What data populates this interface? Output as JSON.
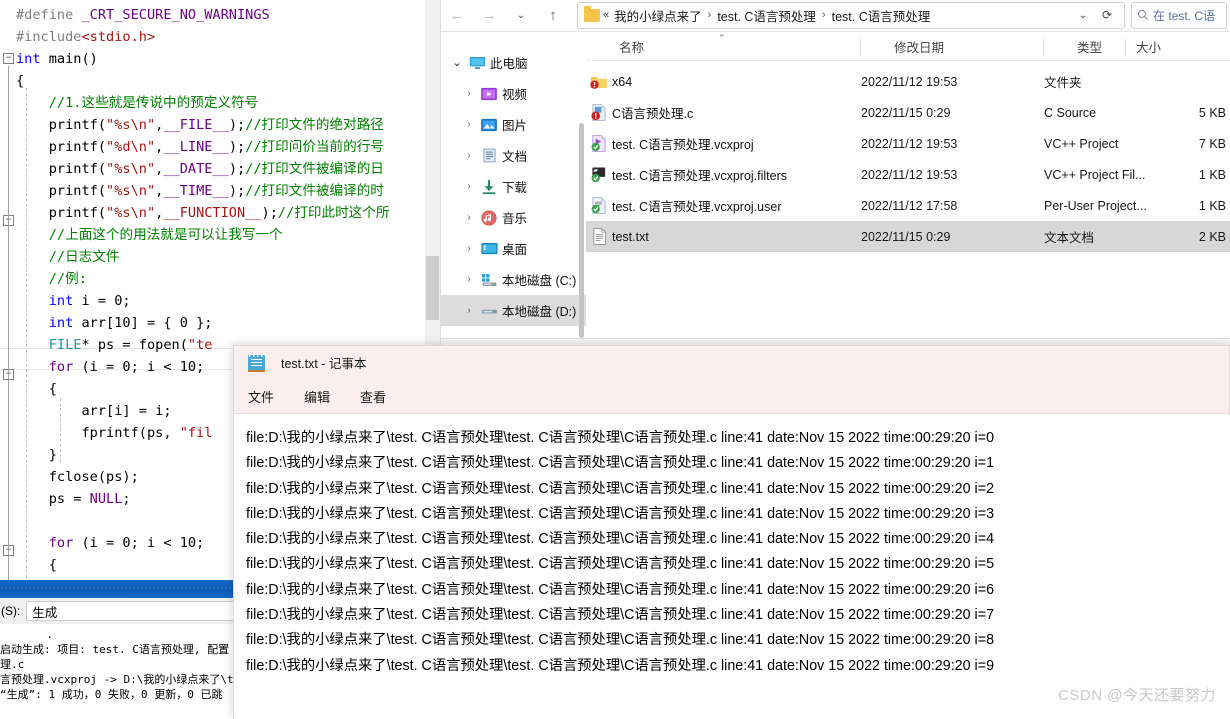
{
  "vs": {
    "code_lines": [
      [
        {
          "t": "#define ",
          "c": "gray"
        },
        {
          "t": "_CRT_SECURE_NO_WARNINGS",
          "c": "purple"
        }
      ],
      [
        {
          "t": "#include",
          "c": "gray"
        },
        {
          "t": "<stdio.h>",
          "c": "red"
        }
      ],
      [
        {
          "t": "int",
          "c": "blue"
        },
        {
          "t": " main()",
          "c": "black"
        }
      ],
      [
        {
          "t": "{",
          "c": "black"
        }
      ],
      [
        {
          "t": "    //1.这些就是传说中的预定义符号",
          "c": "green"
        }
      ],
      [
        {
          "t": "    printf(",
          "c": "black"
        },
        {
          "t": "\"%s\\n\"",
          "c": "str"
        },
        {
          "t": ",",
          "c": "black"
        },
        {
          "t": "__FILE__",
          "c": "purple"
        },
        {
          "t": ");",
          "c": "black"
        },
        {
          "t": "//打印文件的绝对路径",
          "c": "green"
        }
      ],
      [
        {
          "t": "    printf(",
          "c": "black"
        },
        {
          "t": "\"%d\\n\"",
          "c": "str"
        },
        {
          "t": ",",
          "c": "black"
        },
        {
          "t": "__LINE__",
          "c": "purple"
        },
        {
          "t": ");",
          "c": "black"
        },
        {
          "t": "//打印问价当前的行号",
          "c": "green"
        }
      ],
      [
        {
          "t": "    printf(",
          "c": "black"
        },
        {
          "t": "\"%s\\n\"",
          "c": "str"
        },
        {
          "t": ",",
          "c": "black"
        },
        {
          "t": "__DATE__",
          "c": "purple"
        },
        {
          "t": ");",
          "c": "black"
        },
        {
          "t": "//打印文件被编译的日",
          "c": "green"
        }
      ],
      [
        {
          "t": "    printf(",
          "c": "black"
        },
        {
          "t": "\"%s\\n\"",
          "c": "str"
        },
        {
          "t": ",",
          "c": "black"
        },
        {
          "t": "__TIME__",
          "c": "purple"
        },
        {
          "t": ");",
          "c": "black"
        },
        {
          "t": "//打印文件被编译的时",
          "c": "green"
        }
      ],
      [
        {
          "t": "    printf(",
          "c": "black"
        },
        {
          "t": "\"%s\\n\"",
          "c": "str"
        },
        {
          "t": ",",
          "c": "black"
        },
        {
          "t": "__FUNCTION__",
          "c": "red"
        },
        {
          "t": ");",
          "c": "black"
        },
        {
          "t": "//打印此时这个所",
          "c": "green"
        }
      ],
      [
        {
          "t": "    //上面这个的用法就是可以让我写一个",
          "c": "green"
        }
      ],
      [
        {
          "t": "    //日志文件",
          "c": "green"
        }
      ],
      [
        {
          "t": "    //例:",
          "c": "green"
        }
      ],
      [
        {
          "t": "    int",
          "c": "blue"
        },
        {
          "t": " i = ",
          "c": "black"
        },
        {
          "t": "0",
          "c": "black"
        },
        {
          "t": ";",
          "c": "black"
        }
      ],
      [
        {
          "t": "    int",
          "c": "blue"
        },
        {
          "t": " arr[",
          "c": "black"
        },
        {
          "t": "10",
          "c": "black"
        },
        {
          "t": "] = { ",
          "c": "black"
        },
        {
          "t": "0",
          "c": "black"
        },
        {
          "t": " };",
          "c": "black"
        }
      ],
      [
        {
          "t": "    FILE",
          "c": "teal"
        },
        {
          "t": "* ps = fopen(",
          "c": "black"
        },
        {
          "t": "\"te",
          "c": "str"
        }
      ],
      [
        {
          "t": "    for",
          "c": "purple"
        },
        {
          "t": " (i = ",
          "c": "black"
        },
        {
          "t": "0",
          "c": "black"
        },
        {
          "t": "; i < ",
          "c": "black"
        },
        {
          "t": "10",
          "c": "black"
        },
        {
          "t": ";",
          "c": "black"
        }
      ],
      [
        {
          "t": "    {",
          "c": "black"
        }
      ],
      [
        {
          "t": "        arr[i] = i;",
          "c": "black"
        }
      ],
      [
        {
          "t": "        fprintf(ps, ",
          "c": "black"
        },
        {
          "t": "\"fil",
          "c": "str"
        }
      ],
      [
        {
          "t": "    }",
          "c": "black"
        }
      ],
      [
        {
          "t": "    fclose(ps);",
          "c": "black"
        }
      ],
      [
        {
          "t": "    ps = ",
          "c": "black"
        },
        {
          "t": "NULL",
          "c": "purple"
        },
        {
          "t": ";",
          "c": "black"
        }
      ],
      [
        {
          "t": "",
          "c": "black"
        }
      ],
      [
        {
          "t": "    for",
          "c": "purple"
        },
        {
          "t": " (i = ",
          "c": "black"
        },
        {
          "t": "0",
          "c": "black"
        },
        {
          "t": "; i < ",
          "c": "black"
        },
        {
          "t": "10",
          "c": "black"
        },
        {
          "t": ";",
          "c": "black"
        }
      ],
      [
        {
          "t": "    {",
          "c": "black"
        }
      ]
    ],
    "output_label": "(S):",
    "output_combo_value": "生成",
    "output_lines": [
      "       .",
      "启动生成: 项目: test. C语言预处理, 配置",
      "理.c",
      "言预处理.vcxproj -> D:\\我的小绿点来了\\t",
      "“生成”: 1 成功，0 失败，0 更新，0 已跳"
    ]
  },
  "explorer": {
    "nav": {
      "back": "←",
      "forward": "→",
      "recent": "⌄",
      "up": "↑"
    },
    "breadcrumb": {
      "overflow": "«",
      "items": [
        "我的小绿点来了",
        "test. C语言预处理",
        "test. C语言预处理"
      ],
      "separator": "›",
      "dropdown": "⌄",
      "refresh": "⟳"
    },
    "search": {
      "placeholder": "在 test. C语",
      "icon": "search-icon"
    },
    "tree": [
      {
        "label": "此电脑",
        "twisty": "⌄",
        "icon": "monitor",
        "indent": 0,
        "selected": false
      },
      {
        "label": "视频",
        "twisty": "›",
        "icon": "video",
        "indent": 1,
        "selected": false
      },
      {
        "label": "图片",
        "twisty": "›",
        "icon": "pictures",
        "indent": 1,
        "selected": false
      },
      {
        "label": "文档",
        "twisty": "›",
        "icon": "documents",
        "indent": 1,
        "selected": false
      },
      {
        "label": "下载",
        "twisty": "›",
        "icon": "downloads",
        "indent": 1,
        "selected": false
      },
      {
        "label": "音乐",
        "twisty": "›",
        "icon": "music",
        "indent": 1,
        "selected": false
      },
      {
        "label": "桌面",
        "twisty": "›",
        "icon": "desktop",
        "indent": 1,
        "selected": false
      },
      {
        "label": "本地磁盘 (C:)",
        "twisty": "›",
        "icon": "drive-c",
        "indent": 1,
        "selected": false
      },
      {
        "label": "本地磁盘 (D:)",
        "twisty": "›",
        "icon": "drive-d",
        "indent": 1,
        "selected": true
      }
    ],
    "columns": [
      {
        "label": "名称",
        "sorted": true,
        "caret": "⌃"
      },
      {
        "label": "修改日期",
        "sorted": false
      },
      {
        "label": "类型",
        "sorted": false
      },
      {
        "label": "大小",
        "sorted": false
      }
    ],
    "files": [
      {
        "name": "x64",
        "date": "2022/11/12 19:53",
        "type": "文件夹",
        "size": "",
        "icon": "folder-warning",
        "selected": false
      },
      {
        "name": "C语言预处理.c",
        "date": "2022/11/15 0:29",
        "type": "C Source",
        "size": "5 KB",
        "icon": "c-source-warning",
        "selected": false
      },
      {
        "name": "test. C语言预处理.vcxproj",
        "date": "2022/11/12 19:53",
        "type": "VC++ Project",
        "size": "7 KB",
        "icon": "vcxproj",
        "selected": false
      },
      {
        "name": "test. C语言预处理.vcxproj.filters",
        "date": "2022/11/12 19:53",
        "type": "VC++ Project Fil...",
        "size": "1 KB",
        "icon": "vcxproj-filters",
        "selected": false
      },
      {
        "name": "test. C语言预处理.vcxproj.user",
        "date": "2022/11/12 17:58",
        "type": "Per-User Project...",
        "size": "1 KB",
        "icon": "vcxproj-user",
        "selected": false
      },
      {
        "name": "test.txt",
        "date": "2022/11/15 0:29",
        "type": "文本文档",
        "size": "2 KB",
        "icon": "text-document",
        "selected": true
      }
    ]
  },
  "notepad": {
    "title": "test.txt - 记事本",
    "menu": [
      "文件",
      "编辑",
      "查看"
    ],
    "lines": [
      "file:D:\\我的小绿点来了\\test. C语言预处理\\test. C语言预处理\\C语言预处理.c line:41 date:Nov 15 2022 time:00:29:20 i=0",
      "file:D:\\我的小绿点来了\\test. C语言预处理\\test. C语言预处理\\C语言预处理.c line:41 date:Nov 15 2022 time:00:29:20 i=1",
      "file:D:\\我的小绿点来了\\test. C语言预处理\\test. C语言预处理\\C语言预处理.c line:41 date:Nov 15 2022 time:00:29:20 i=2",
      "file:D:\\我的小绿点来了\\test. C语言预处理\\test. C语言预处理\\C语言预处理.c line:41 date:Nov 15 2022 time:00:29:20 i=3",
      "file:D:\\我的小绿点来了\\test. C语言预处理\\test. C语言预处理\\C语言预处理.c line:41 date:Nov 15 2022 time:00:29:20 i=4",
      "file:D:\\我的小绿点来了\\test. C语言预处理\\test. C语言预处理\\C语言预处理.c line:41 date:Nov 15 2022 time:00:29:20 i=5",
      "file:D:\\我的小绿点来了\\test. C语言预处理\\test. C语言预处理\\C语言预处理.c line:41 date:Nov 15 2022 time:00:29:20 i=6",
      "file:D:\\我的小绿点来了\\test. C语言预处理\\test. C语言预处理\\C语言预处理.c line:41 date:Nov 15 2022 time:00:29:20 i=7",
      "file:D:\\我的小绿点来了\\test. C语言预处理\\test. C语言预处理\\C语言预处理.c line:41 date:Nov 15 2022 time:00:29:20 i=8",
      "file:D:\\我的小绿点来了\\test. C语言预处理\\test. C语言预处理\\C语言预处理.c line:41 date:Nov 15 2022 time:00:29:20 i=9"
    ]
  },
  "watermark": "CSDN @今天还要努力",
  "colors": {
    "notepad_chrome": "#faeeee",
    "selection": "#d7d7d7",
    "splitter_blue": "#1269c8",
    "comment_green": "#008000",
    "keyword_blue": "#0000ff",
    "macro_purple": "#6f008a",
    "string_red": "#a31515"
  }
}
